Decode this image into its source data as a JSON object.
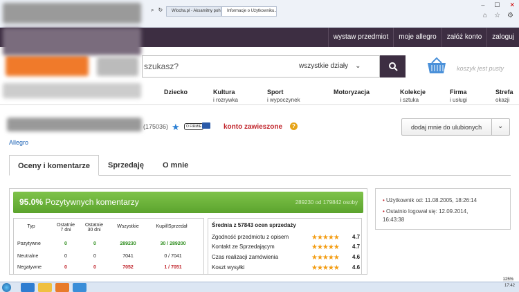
{
  "browser": {
    "tabs": [
      {
        "label": "Wlocha.pl - Aksamitny pohlebogie..."
      },
      {
        "label": "Informacje o Użytkowniku..."
      }
    ]
  },
  "header": {
    "nav_links": [
      "wystaw przedmiot",
      "moje allegro",
      "załóż konto",
      "zaloguj"
    ]
  },
  "search": {
    "placeholder": "szukasz?",
    "department": "wszystkie działy"
  },
  "basket": {
    "text": "koszyk jest pusty"
  },
  "categories": [
    {
      "name": "Dziecko",
      "sub": ""
    },
    {
      "name": "Kultura",
      "sub": "i rozrywka"
    },
    {
      "name": "Sport",
      "sub": "i wypoczynek"
    },
    {
      "name": "Motoryzacja",
      "sub": ""
    },
    {
      "name": "Kolekcje",
      "sub": "i sztuka"
    },
    {
      "name": "Firma",
      "sub": "i usługi"
    },
    {
      "name": "Strefa",
      "sub": "okazji"
    }
  ],
  "profile": {
    "rating_count": "(175036)",
    "status": "konto zawieszone",
    "add_favorite": "dodaj mnie do ulubionych",
    "breadcrumb": "Allegro"
  },
  "page_tabs": [
    "Oceny i komentarze",
    "Sprzedaję",
    "O mnie"
  ],
  "summary": {
    "percent": "95.0%",
    "label": "Pozytywnych komentarzy",
    "of_text": "289230 od 179842 osoby"
  },
  "table": {
    "headers": [
      "Typ",
      "Ostatnie 7 dni",
      "Ostatnie 30 dni",
      "Wszystkie",
      "Kupił/Sprzedał"
    ],
    "rows": [
      {
        "type": "Pozytywne",
        "d7": "0",
        "d30": "0",
        "all": "289230",
        "bs": "30 / 289200"
      },
      {
        "type": "Neutralne",
        "d7": "0",
        "d30": "0",
        "all": "7041",
        "bs": "0 / 7041"
      },
      {
        "type": "Negatywne",
        "d7": "0",
        "d30": "0",
        "all": "7052",
        "bs": "1 / 7051"
      }
    ]
  },
  "ratings": {
    "title": "Średnia z 57843 ocen sprzedaży",
    "items": [
      {
        "label": "Zgodność przedmiotu z opisem",
        "value": "4.7"
      },
      {
        "label": "Kontakt ze Sprzedającym",
        "value": "4.7"
      },
      {
        "label": "Czas realizacji zamówienia",
        "value": "4.6"
      },
      {
        "label": "Koszt wysyłki",
        "value": "4.6"
      }
    ]
  },
  "sidebar": {
    "user_since": "Użytkownik od: 11.08.2005, 18:26:14",
    "last_login": "Ostatnio logował się: 12.09.2014,",
    "last_login_time": "16:43:38"
  },
  "status_bar": {
    "zoom": "125%",
    "clock": "17:42"
  }
}
